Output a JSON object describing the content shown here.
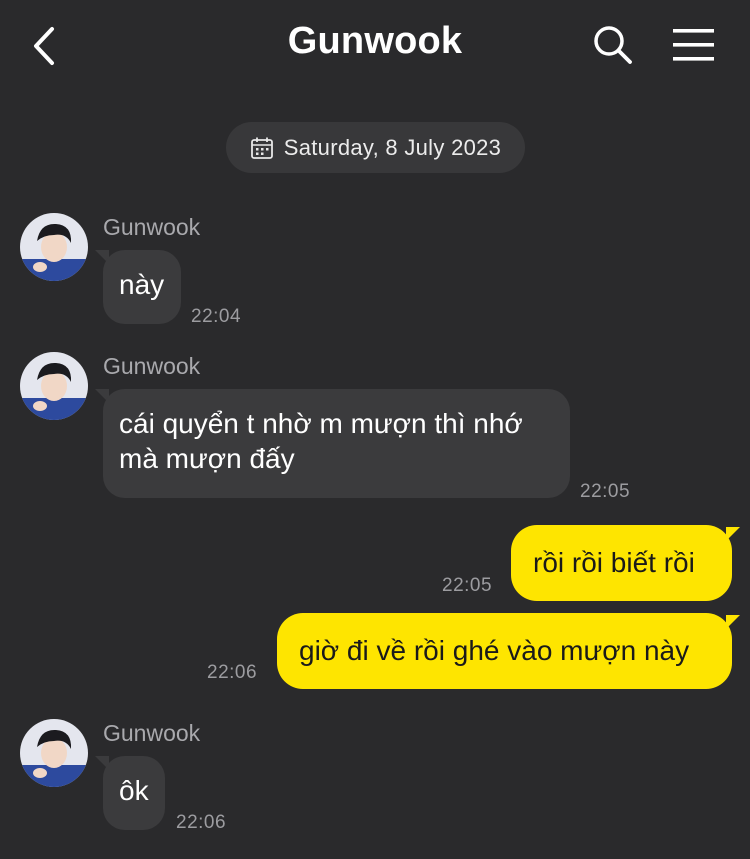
{
  "header": {
    "title": "Gunwook"
  },
  "date_divider": {
    "label": "Saturday, 8 July 2023"
  },
  "messages": [
    {
      "sender": "Gunwook",
      "text": "này",
      "time": "22:04"
    },
    {
      "sender": "Gunwook",
      "text": "cái quyển t nhờ m mượn thì nhớ mà mượn đấy",
      "time": "22:05"
    },
    {
      "text": "rồi rồi biết rồi",
      "time": "22:05"
    },
    {
      "text": "giờ đi về rồi ghé vào mượn này",
      "time": "22:06"
    },
    {
      "sender": "Gunwook",
      "text": "ôk",
      "time": "22:06"
    }
  ],
  "colors": {
    "background": "#2a2a2c",
    "incoming_bubble": "#3b3b3d",
    "outgoing_bubble": "#fee500",
    "date_pill": "#38383a"
  }
}
